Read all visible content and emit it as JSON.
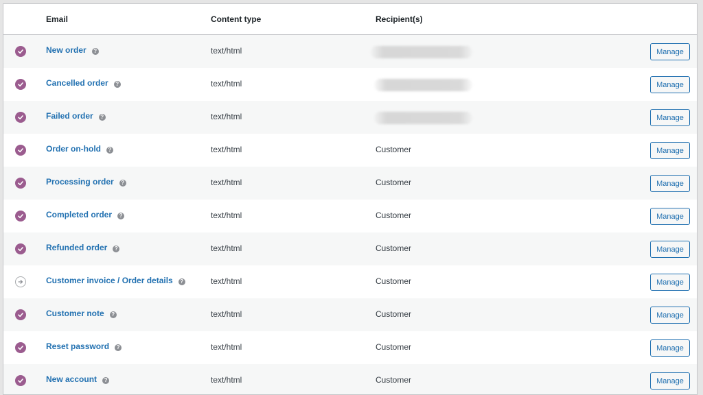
{
  "header": {
    "email": "Email",
    "content_type": "Content type",
    "recipients": "Recipient(s)"
  },
  "help_glyph": "?",
  "status_icons": {
    "enabled": "checkmark-circle-icon",
    "manual": "arrow-right-circle-icon"
  },
  "colors": {
    "enabled": "#9b5c8f",
    "link": "#2271b1",
    "row_alt": "#f6f7f7"
  },
  "rows": [
    {
      "name": "New order",
      "content_type": "text/html",
      "recipient": "",
      "status": "enabled",
      "manage": "Manage"
    },
    {
      "name": "Cancelled order",
      "content_type": "text/html",
      "recipient": "",
      "status": "enabled",
      "manage": "Manage"
    },
    {
      "name": "Failed order",
      "content_type": "text/html",
      "recipient": "",
      "status": "enabled",
      "manage": "Manage"
    },
    {
      "name": "Order on-hold",
      "content_type": "text/html",
      "recipient": "Customer",
      "status": "enabled",
      "manage": "Manage"
    },
    {
      "name": "Processing order",
      "content_type": "text/html",
      "recipient": "Customer",
      "status": "enabled",
      "manage": "Manage"
    },
    {
      "name": "Completed order",
      "content_type": "text/html",
      "recipient": "Customer",
      "status": "enabled",
      "manage": "Manage"
    },
    {
      "name": "Refunded order",
      "content_type": "text/html",
      "recipient": "Customer",
      "status": "enabled",
      "manage": "Manage"
    },
    {
      "name": "Customer invoice / Order details",
      "content_type": "text/html",
      "recipient": "Customer",
      "status": "manual",
      "manage": "Manage"
    },
    {
      "name": "Customer note",
      "content_type": "text/html",
      "recipient": "Customer",
      "status": "enabled",
      "manage": "Manage"
    },
    {
      "name": "Reset password",
      "content_type": "text/html",
      "recipient": "Customer",
      "status": "enabled",
      "manage": "Manage"
    },
    {
      "name": "New account",
      "content_type": "text/html",
      "recipient": "Customer",
      "status": "enabled",
      "manage": "Manage"
    }
  ]
}
